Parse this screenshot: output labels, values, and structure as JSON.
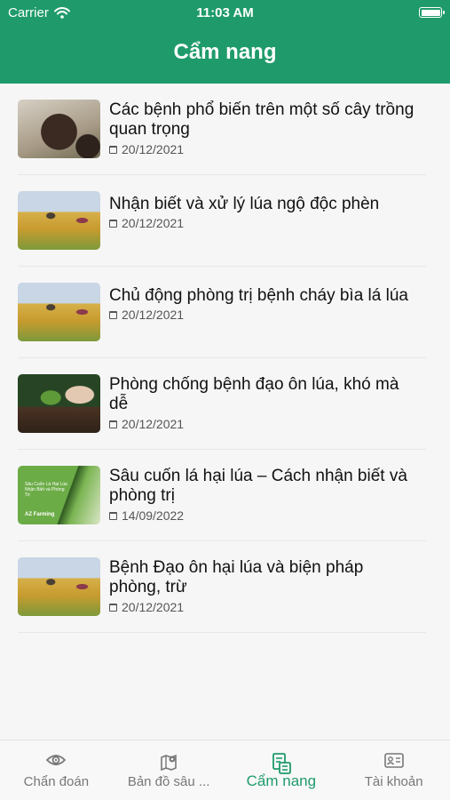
{
  "status_bar": {
    "carrier": "Carrier",
    "time": "11:03 AM"
  },
  "header": {
    "title": "Cẩm nang"
  },
  "articles": [
    {
      "title": "Các bệnh phổ biến trên một  số cây trồng quan trọng",
      "date": "20/12/2021",
      "thumb": "pepper"
    },
    {
      "title": "Nhận biết và xử lý lúa ngộ độc phèn",
      "date": "20/12/2021",
      "thumb": "rice-field"
    },
    {
      "title": "Chủ động phòng trị bệnh cháy bìa lá lúa",
      "date": "20/12/2021",
      "thumb": "rice-field"
    },
    {
      "title": "Phòng chống bệnh đạo ôn lúa, khó mà dễ",
      "date": "20/12/2021",
      "thumb": "sprout"
    },
    {
      "title": "Sâu cuốn lá hại lúa – Cách nhận biết và phòng trị",
      "date": "14/09/2022",
      "thumb": "cover"
    },
    {
      "title": "Bệnh Đạo ôn hại lúa và biện pháp phòng, trừ",
      "date": "20/12/2021",
      "thumb": "rice-field"
    }
  ],
  "thumb_cover": {
    "text": "Sâu Cuốn Lá Hại Lúa Nhận Biết và Phòng Trị",
    "brand": "AZ Farming"
  },
  "tabs": [
    {
      "label": "Chẩn đoán",
      "icon": "eye-icon",
      "active": false
    },
    {
      "label": "Bản đồ sâu ...",
      "icon": "map-pin-icon",
      "active": false
    },
    {
      "label": "Cẩm nang",
      "icon": "handbook-icon",
      "active": true
    },
    {
      "label": "Tài khoản",
      "icon": "id-card-icon",
      "active": false
    }
  ],
  "colors": {
    "primary": "#1f9b6b",
    "inactive": "#777777",
    "background": "#f6f6f6"
  }
}
